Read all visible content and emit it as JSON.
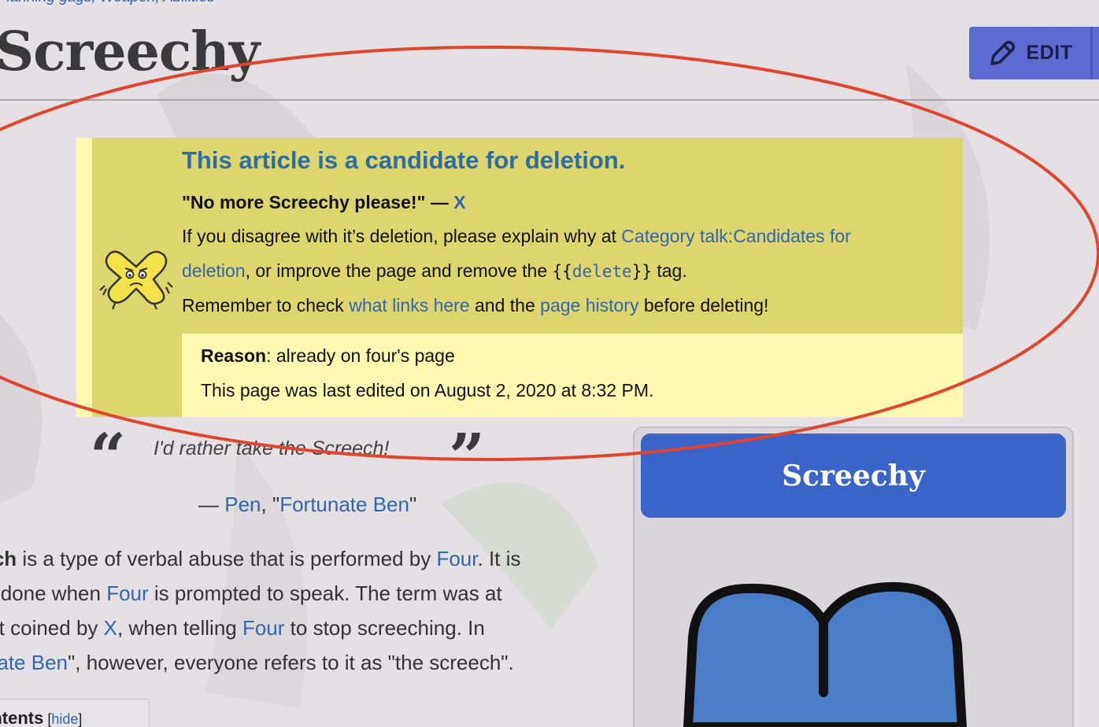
{
  "breadcrumb": "Planning gags, Weapon, Abilities",
  "page": {
    "title": "Screechy",
    "edit_label": "EDIT"
  },
  "notice": {
    "heading": "This article is a candidate for deletion.",
    "quote": "\"No more Screechy please!\" — ",
    "quote_author": "X",
    "line1_prefix": "If you disagree with it’s deletion, please explain why at ",
    "line1_link": "Category talk:Candidates for",
    "line2_link": "deletion",
    "line2_mid": ", or improve the page and remove the ",
    "code_open": "{{",
    "code_word": "delete",
    "code_close": "}}",
    "line2_suffix": " tag.",
    "line3_prefix": "Remember to check ",
    "line3_link1": "what links here",
    "line3_mid": " and the ",
    "line3_link2": "page history",
    "line3_suffix": " before deleting!",
    "reason_label": "Reason",
    "reason_text": ": already on four's page",
    "edited_text": "This page was last edited on August 2, 2020 at 8:32 PM."
  },
  "quote": {
    "open_mark": "“",
    "close_mark": "”",
    "text": "I'd rather take the Screech!",
    "attr_dash": "— ",
    "attr_speaker": "Pen",
    "attr_sep": ", \"",
    "attr_episode": "Fortunate Ben",
    "attr_end": "\""
  },
  "body": {
    "l1_bold": "Screech",
    "l1_text": " is a type of verbal abuse that is performed by ",
    "l1_link": "Four",
    "l1_end": ". It is",
    "l2_text": "generally done when ",
    "l2_link": "Four",
    "l2_end": " is prompted to speak. The term was at",
    "l3_text": "first coined by ",
    "l3_link1": "X",
    "l3_mid": ", when telling ",
    "l3_link2": "Four",
    "l3_end": " to stop screeching. In",
    "l4_start": "\"",
    "l4_link": "Fortunate Ben",
    "l4_end": "\", however, everyone refers to it as \"the screech\"."
  },
  "toc": {
    "title": "Contents",
    "hide_open": " [",
    "hide_label": "hide",
    "hide_close": "]"
  },
  "infobox": {
    "title": "Screechy"
  }
}
